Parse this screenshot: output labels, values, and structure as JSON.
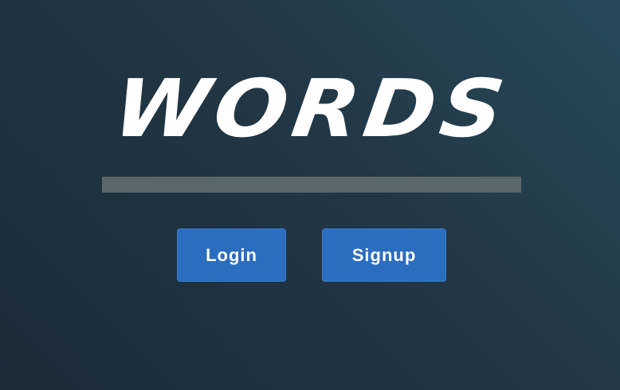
{
  "logo": {
    "text": "WORDS"
  },
  "actions": {
    "login_label": "Login",
    "signup_label": "Signup"
  },
  "colors": {
    "background_dark": "#1d2b37",
    "background_light": "#27495a",
    "divider": "#5a676c",
    "button": "#2b6dbf",
    "text": "#ffffff"
  }
}
